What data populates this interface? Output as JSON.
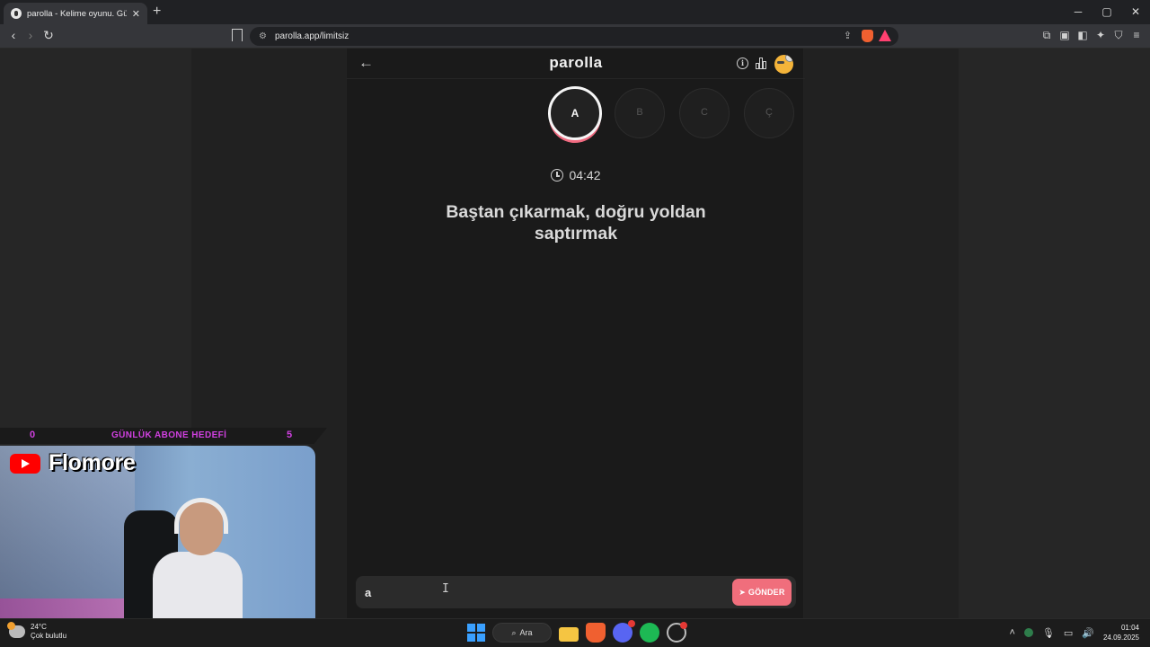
{
  "browser": {
    "tab_title": "parolla - Kelime oyunu. Günlük k",
    "tab_close": "✕",
    "new_tab": "+",
    "url": "parolla.app/limitsiz",
    "win_min": "─",
    "win_max": "▢",
    "win_close": "✕"
  },
  "app": {
    "title": "parolla",
    "info_glyph": "i",
    "letters": [
      {
        "label": "A",
        "active": true
      },
      {
        "label": "B",
        "active": false
      },
      {
        "label": "C",
        "active": false
      },
      {
        "label": "Ç",
        "active": false
      }
    ],
    "timer": "04:42",
    "question": "Baştan çıkarmak, doğru yoldan saptırmak",
    "answer_value": "a",
    "send_label": "GÖNDER"
  },
  "stream": {
    "goal_current": "0",
    "goal_label": "GÜNLÜK ABONE HEDEFİ",
    "goal_target": "5",
    "channel_name": "Flomore"
  },
  "taskbar": {
    "temperature": "24°C",
    "weather": "Çok bulutlu",
    "search_label": "Ara",
    "time": "01:04",
    "date": "24.09.2025"
  },
  "colors": {
    "accent": "#f06e7c",
    "goal_text": "#d040e0"
  },
  "icons": [
    "back-arrow-icon",
    "info-icon",
    "stats-icon",
    "clock-icon",
    "send-icon",
    "youtube-icon"
  ]
}
